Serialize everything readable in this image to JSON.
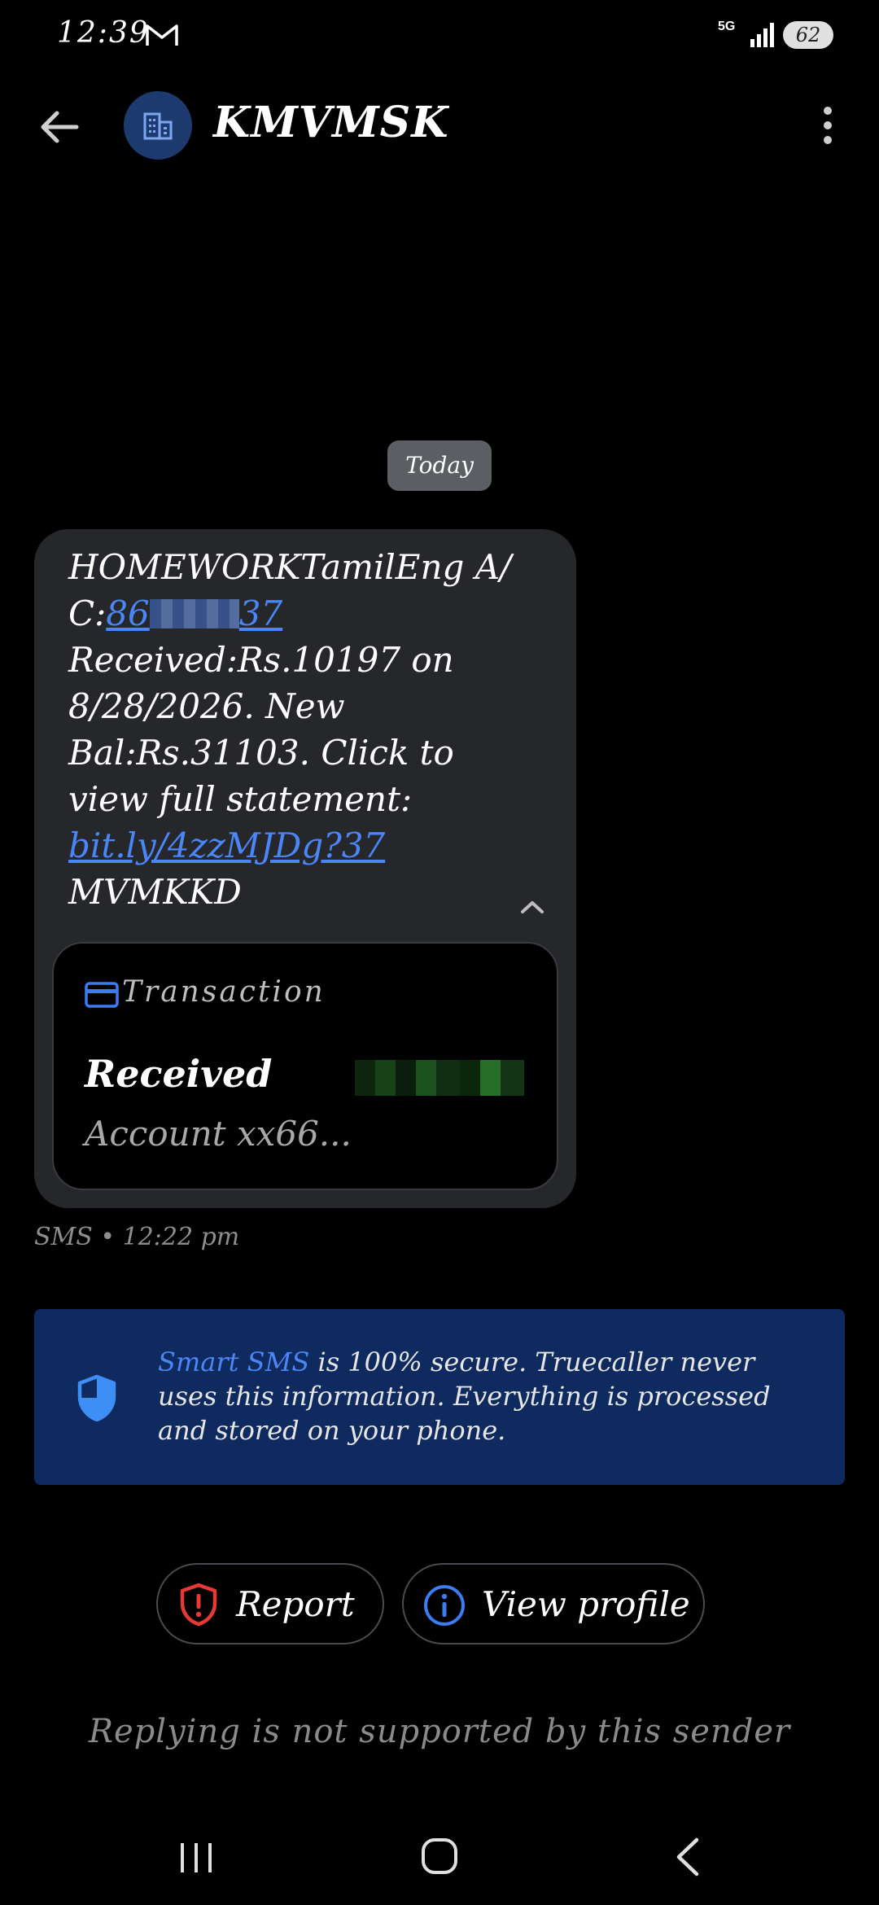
{
  "status_bar": {
    "time": "12:39",
    "network": "5G",
    "battery": "62"
  },
  "header": {
    "sender": "KMVMSK"
  },
  "conversation": {
    "date_chip": "Today",
    "message": {
      "line1": "HOMEWORKTamilEng A/",
      "account_prefix": "C:",
      "account_start": "86",
      "account_end": "37",
      "body": "Received:Rs.10197 on 8/28/2026. New Bal:Rs.31103. Click to view full statement:",
      "link": "bit.ly/4zzMJDg?37",
      "signature": "MVMKKD"
    },
    "transaction_card": {
      "label": "Transaction",
      "title": "Received",
      "account": "Account xx66..."
    },
    "meta": "SMS • 12:22 pm"
  },
  "banner": {
    "highlight": "Smart SMS",
    "text": " is 100% secure. Truecaller never uses this information. Everything is processed and stored on your phone."
  },
  "actions": {
    "report_label": "Report",
    "profile_label": "View profile"
  },
  "footer": {
    "no_reply": "Replying is not supported by this sender"
  },
  "colors": {
    "accent": "#4a86f5",
    "banner_bg": "#0e2a5e",
    "bubble_bg": "#26272b",
    "report_red": "#e53935"
  }
}
